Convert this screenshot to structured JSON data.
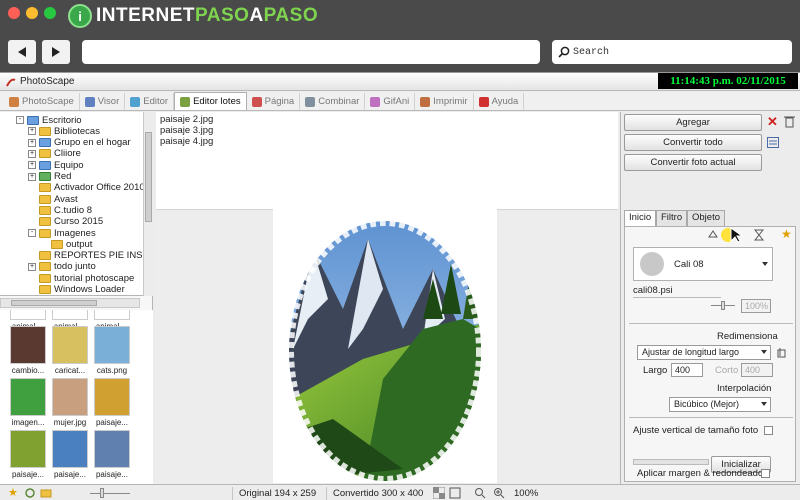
{
  "brand": {
    "part1": "INTERNET",
    "part2": "PASO",
    "part3": "A",
    "part4": "PASO",
    "logo_letter": "i"
  },
  "browser": {
    "search_placeholder": "Search",
    "back_icon": "arrow-left-icon",
    "forward_icon": "arrow-right-icon"
  },
  "colors": {
    "brand_green": "#7fd44f",
    "clock_green": "#00ff3a",
    "chrome_bg": "#4a4a4a"
  },
  "app": {
    "title": "PhotoScape",
    "clock": "11:14:43 p.m. 02/11/2015",
    "tabs": [
      {
        "label": "PhotoScape",
        "color": "#d08040",
        "active": false
      },
      {
        "label": "Visor",
        "color": "#6080c0",
        "active": false
      },
      {
        "label": "Editor",
        "color": "#50a0d0",
        "active": false
      },
      {
        "label": "Editor lotes",
        "color": "#7aa040",
        "active": true
      },
      {
        "label": "Página",
        "color": "#d05050",
        "active": false
      },
      {
        "label": "Combinar",
        "color": "#8090a0",
        "active": false
      },
      {
        "label": "GifAni",
        "color": "#c070c0",
        "active": false
      },
      {
        "label": "Imprimir",
        "color": "#c07040",
        "active": false
      },
      {
        "label": "Ayuda",
        "color": "#d03030",
        "active": false
      }
    ]
  },
  "folder_tree": [
    {
      "label": "Escritorio",
      "indent": 0,
      "icon": "blue",
      "expander": "-"
    },
    {
      "label": "Bibliotecas",
      "indent": 1,
      "icon": "yellow",
      "expander": "+"
    },
    {
      "label": "Grupo en el hogar",
      "indent": 1,
      "icon": "blue",
      "expander": "+"
    },
    {
      "label": "Cliiore",
      "indent": 1,
      "icon": "yellow",
      "expander": "+"
    },
    {
      "label": "Equipo",
      "indent": 1,
      "icon": "blue",
      "expander": "+"
    },
    {
      "label": "Red",
      "indent": 1,
      "icon": "green",
      "expander": "+"
    },
    {
      "label": "Activador Office 2010",
      "indent": 1,
      "icon": "yellow",
      "expander": ""
    },
    {
      "label": "Avast",
      "indent": 1,
      "icon": "yellow",
      "expander": ""
    },
    {
      "label": "C.tudio 8",
      "indent": 1,
      "icon": "yellow",
      "expander": ""
    },
    {
      "label": "Curso 2015",
      "indent": 1,
      "icon": "yellow",
      "expander": ""
    },
    {
      "label": "Imagenes",
      "indent": 1,
      "icon": "yellow",
      "expander": "-"
    },
    {
      "label": "output",
      "indent": 2,
      "icon": "yellow",
      "expander": ""
    },
    {
      "label": "REPORTES PIE INSCR",
      "indent": 1,
      "icon": "yellow",
      "expander": ""
    },
    {
      "label": "todo junto",
      "indent": 1,
      "icon": "yellow",
      "expander": "+"
    },
    {
      "label": "tutorial photoscape",
      "indent": 1,
      "icon": "yellow",
      "expander": ""
    },
    {
      "label": "Windows Loader",
      "indent": 1,
      "icon": "yellow",
      "expander": ""
    }
  ],
  "thumbnails": [
    {
      "caption": "animal ...",
      "color": "#ffffff"
    },
    {
      "caption": "animal ...",
      "color": "#ffffff"
    },
    {
      "caption": "animal ...",
      "color": "#ffffff"
    },
    {
      "caption": "cambio...",
      "color": "#5a3a30"
    },
    {
      "caption": "caricat...",
      "color": "#d6c060"
    },
    {
      "caption": "cats.png",
      "color": "#7ab0d8"
    },
    {
      "caption": "imagen...",
      "color": "#40a040"
    },
    {
      "caption": "mujer.jpg",
      "color": "#c8a080"
    },
    {
      "caption": "paisaje...",
      "color": "#d0a030"
    },
    {
      "caption": "paisaje...",
      "color": "#80a030"
    },
    {
      "caption": "paisaje...",
      "color": "#4a80c0"
    },
    {
      "caption": "paisaje...",
      "color": "#6080b0"
    }
  ],
  "file_list": [
    "paisaje 2.jpg",
    "paisaje 3.jpg",
    "paisaje 4.jpg"
  ],
  "right_panel": {
    "add_button": "Agregar",
    "convert_all_button": "Convertir todo",
    "convert_current_button": "Convertir foto actual",
    "tabs": [
      "Inicio",
      "Filtro",
      "Objeto"
    ],
    "frame_name": "Cali 08",
    "frame_file": "cali08.psi",
    "opacity_value": "100%",
    "resize_label": "Redimensiona",
    "resize_mode": "Ajustar de longitud largo",
    "length_label": "Largo",
    "length_value": "400",
    "short_label": "Corto",
    "short_value": "400",
    "interp_label": "Interpolación",
    "interp_value": "Bicúbico (Mejor)",
    "vertical_fit_label": "Ajuste vertical de tamaño foto",
    "init_button": "Inicializar",
    "margin_label": "Aplicar margen & redondeado"
  },
  "status": {
    "original": "Original 194 x 259",
    "converted": "Convertido 300 x 400",
    "zoom": "100%"
  }
}
